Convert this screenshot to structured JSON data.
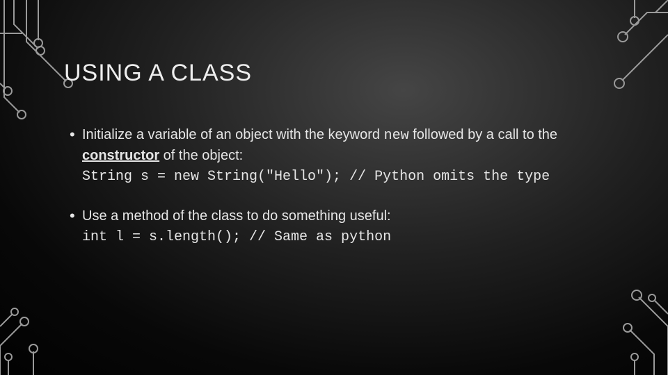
{
  "title": "USING A CLASS",
  "bullets": [
    {
      "pre": "Initialize a variable of an object with the keyword ",
      "kw": "new",
      "mid": " followed by a call to the ",
      "ctor": "constructor",
      "post": " of the object:",
      "code": "String s = new String(\"Hello\"); // Python omits the type"
    },
    {
      "pre": "Use a method of the class to do something useful:",
      "code": "int l = s.length(); // Same as python"
    }
  ]
}
